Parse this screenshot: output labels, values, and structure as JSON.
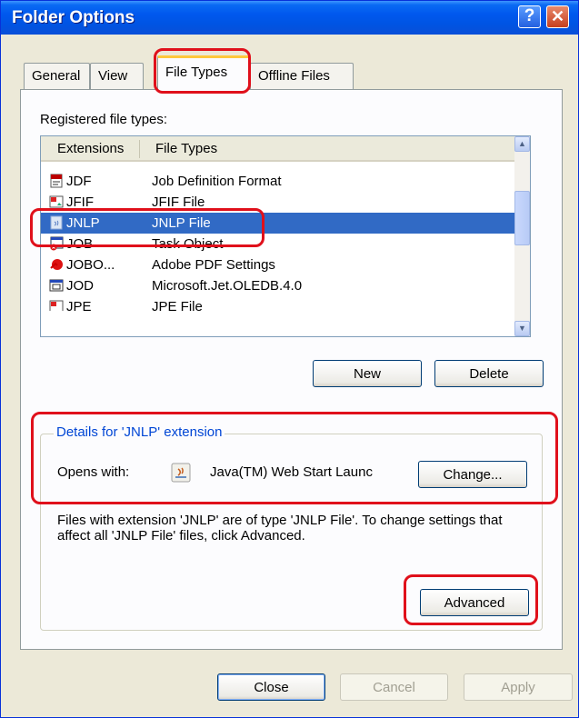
{
  "window": {
    "title": "Folder Options"
  },
  "titlebar": {
    "help_glyph": "?",
    "close_glyph": "✕"
  },
  "tabs": [
    {
      "label": "General"
    },
    {
      "label": "View"
    },
    {
      "label": "File Types",
      "active": true
    },
    {
      "label": "Offline Files"
    }
  ],
  "registered_label": "Registered file types:",
  "list": {
    "columns": [
      "Extensions",
      "File Types"
    ],
    "rows": [
      {
        "ext": "JDF",
        "type": "Job Definition Format",
        "icon": "jdf-file-icon"
      },
      {
        "ext": "JFIF",
        "type": "JFIF File",
        "icon": "image-file-icon"
      },
      {
        "ext": "JNLP",
        "type": "JNLP File",
        "icon": "java-file-icon",
        "selected": true
      },
      {
        "ext": "JOB",
        "type": "Task Object",
        "icon": "task-object-icon"
      },
      {
        "ext": "JOBO...",
        "type": "Adobe PDF Settings",
        "icon": "adobe-pdf-icon"
      },
      {
        "ext": "JOD",
        "type": "Microsoft.Jet.OLEDB.4.0",
        "icon": "database-icon"
      },
      {
        "ext": "JPE",
        "type": "JPE File",
        "icon": "image-file-icon"
      }
    ],
    "scroll_up": "▲",
    "scroll_down": "▼"
  },
  "buttons": {
    "new": "New",
    "delete": "Delete",
    "change": "Change...",
    "advanced": "Advanced",
    "close": "Close",
    "cancel": "Cancel",
    "apply": "Apply"
  },
  "details": {
    "title": "Details for 'JNLP' extension",
    "opens_with_label": "Opens with:",
    "opens_with_app": "Java(TM) Web Start Launc",
    "description": "Files with extension 'JNLP' are of type 'JNLP File'.  To change settings that affect all 'JNLP File' files, click Advanced."
  },
  "colors": {
    "selection": "#316AC5",
    "highlight": "#E0101B",
    "titlebar": "#0054E3"
  }
}
